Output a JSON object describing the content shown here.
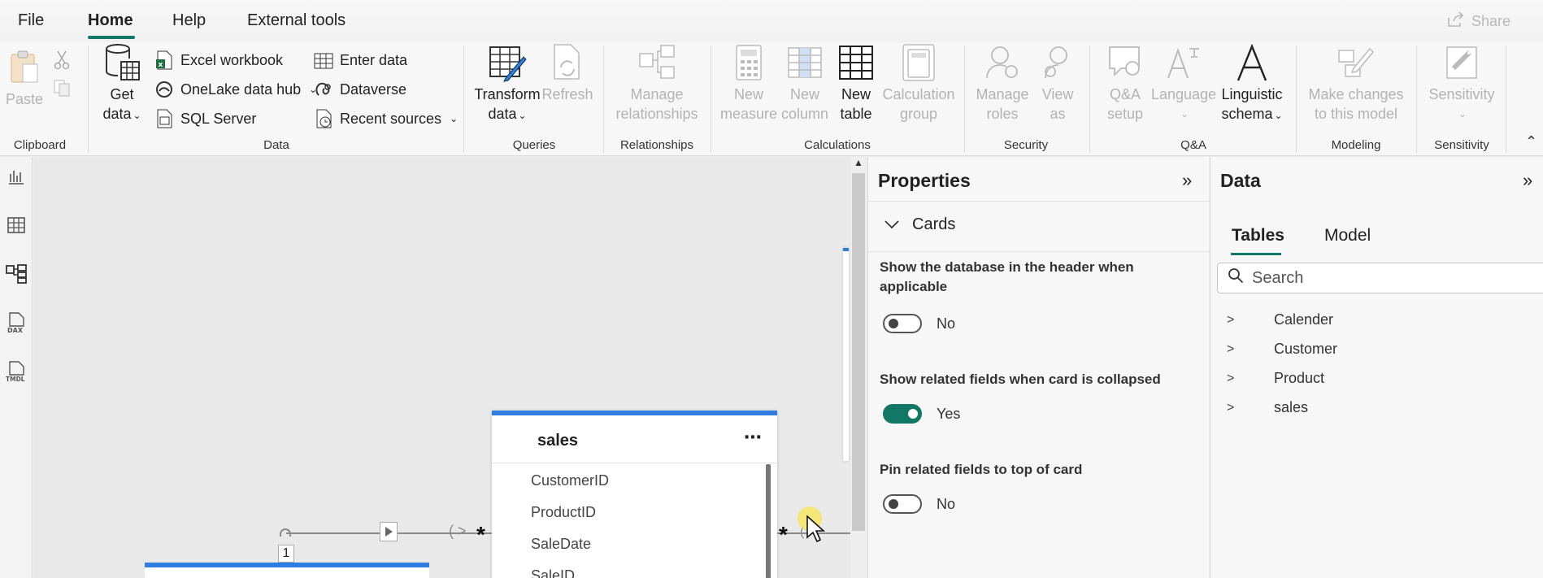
{
  "menu": {
    "items": [
      "File",
      "Home",
      "Help",
      "External tools"
    ],
    "active": "Home",
    "share_label": "Share"
  },
  "ribbon": {
    "clipboard": {
      "paste": "Paste",
      "group": "Clipboard"
    },
    "data": {
      "get_data_1": "Get",
      "get_data_2": "data",
      "excel": "Excel workbook",
      "onelake": "OneLake data hub",
      "sql": "SQL Server",
      "enter_data": "Enter data",
      "dataverse": "Dataverse",
      "recent": "Recent sources",
      "group": "Data"
    },
    "queries": {
      "transform_1": "Transform",
      "transform_2": "data",
      "refresh": "Refresh",
      "group": "Queries"
    },
    "relationships": {
      "manage_1": "Manage",
      "manage_2": "relationships",
      "group": "Relationships"
    },
    "calculations": {
      "new_measure_1": "New",
      "new_measure_2": "measure",
      "new_column_1": "New",
      "new_column_2": "column",
      "new_table_1": "New",
      "new_table_2": "table",
      "calc_group_1": "Calculation",
      "calc_group_2": "group",
      "group": "Calculations"
    },
    "security": {
      "manage_roles_1": "Manage",
      "manage_roles_2": "roles",
      "view_as_1": "View",
      "view_as_2": "as",
      "group": "Security"
    },
    "qa": {
      "setup_1": "Q&A",
      "setup_2": "setup",
      "language": "Language",
      "schema_1": "Linguistic",
      "schema_2": "schema",
      "group": "Q&A"
    },
    "modeling": {
      "make_changes_1": "Make changes",
      "make_changes_2": "to this model",
      "group": "Modeling"
    },
    "sensitivity": {
      "label": "Sensitivity",
      "group": "Sensitivity"
    }
  },
  "canvas": {
    "table_title": "sales",
    "more": "⋯",
    "fields": [
      "CustomerID",
      "ProductID",
      "SaleDate",
      "SaleID"
    ],
    "rel_one": "1",
    "rel_many": "*"
  },
  "properties": {
    "title": "Properties",
    "section": "Cards",
    "settings": [
      {
        "label": "Show the database in the header when applicable",
        "value": "No",
        "on": false
      },
      {
        "label": "Show related fields when card is collapsed",
        "value": "Yes",
        "on": true
      },
      {
        "label": "Pin related fields to top of card",
        "value": "No",
        "on": false
      }
    ]
  },
  "data_pane": {
    "title": "Data",
    "tabs": [
      "Tables",
      "Model"
    ],
    "active_tab": "Tables",
    "search_placeholder": "Search",
    "tables": [
      "Calender",
      "Customer",
      "Product",
      "sales"
    ]
  },
  "colors": {
    "accent": "#117865",
    "table_header": "#2f7de1",
    "disabled": "#b3b3b3"
  }
}
